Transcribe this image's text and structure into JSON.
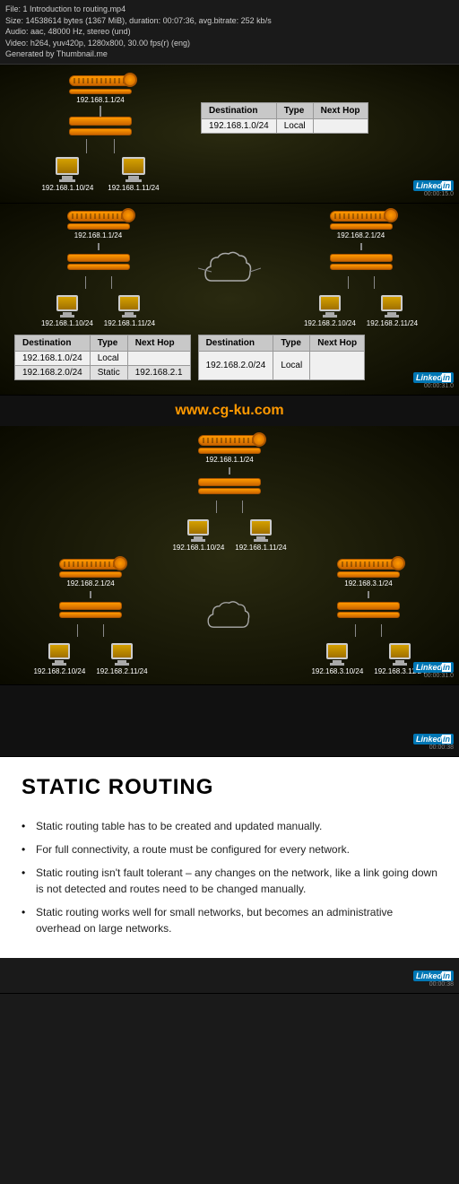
{
  "infobar": {
    "line1": "File: 1 Introduction to routing.mp4",
    "line2": "Size: 14538614 bytes (1367 MiB), duration: 00:07:36, avg.bitrate: 252 kb/s",
    "line3": "Audio: aac, 48000 Hz, stereo (und)",
    "line4": "Video: h264, yuv420p, 1280x800, 30.00 fps(r) (eng)",
    "line5": "Generated by Thumbnail.me"
  },
  "section1": {
    "timecode": "00:00:15.0",
    "network_label1": "192.168.1.1/24",
    "network_label2": "192.168.1.10/24",
    "network_label3": "192.168.1.11/24",
    "table": {
      "headers": [
        "Destination",
        "Type",
        "Next Hop"
      ],
      "rows": [
        [
          "192.168.1.0/24",
          "Local",
          ""
        ]
      ]
    }
  },
  "section2": {
    "timecode": "00:00:31.0",
    "left": {
      "labels": [
        "192.168.1.1/24",
        "192.168.1.10/24",
        "192.168.1.11/24"
      ],
      "table": {
        "headers": [
          "Destination",
          "Type",
          "Next Hop"
        ],
        "rows": [
          [
            "192.168.1.0/24",
            "Local",
            ""
          ],
          [
            "192.168.2.0/24",
            "Static",
            "192.168.2.1"
          ]
        ]
      }
    },
    "right": {
      "labels": [
        "192.168.2.1/24",
        "192.168.2.10/24",
        "192.168.2.11/24"
      ],
      "table": {
        "headers": [
          "Destination",
          "Type",
          "Next Hop"
        ],
        "rows": [
          [
            "192.168.2.0/24",
            "Local",
            ""
          ]
        ]
      }
    }
  },
  "watermark": "www.cg-ku.com",
  "section3": {
    "timecode": "00:00:31.0",
    "top_labels": [
      "192.168.1.1/24",
      "192.168.1.10/24",
      "192.168.1.11/24"
    ],
    "left_labels": [
      "192.168.2.1/24",
      "192.168.2.10/24",
      "192.168.2.11/24"
    ],
    "right_labels": [
      "192.168.3.1/24",
      "192.168.3.10/24",
      "192.168.3.11/24"
    ]
  },
  "section4": {
    "timecode": "00:00:38",
    "title": "STATIC ROUTING",
    "bullets": [
      "Static routing table has to be created and updated manually.",
      "For full connectivity, a route must be configured for every network.",
      "Static routing isn't fault tolerant – any changes on the network, like a link going down is not detected and routes need to be changed manually.",
      "Static routing works well for small networks, but becomes an administrative overhead on large networks."
    ]
  },
  "linkedin": {
    "label": "in",
    "brand": "Linked",
    "suffix": "in"
  }
}
